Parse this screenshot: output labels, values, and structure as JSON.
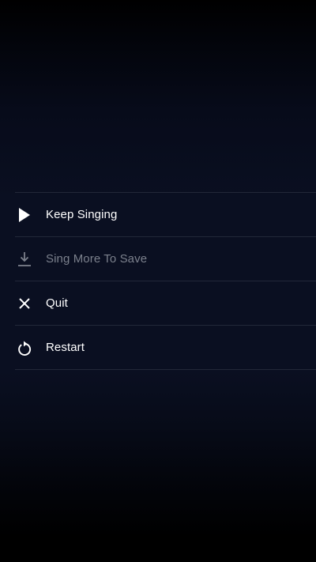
{
  "menu": {
    "items": [
      {
        "label": "Keep Singing",
        "icon": "play-icon",
        "enabled": true
      },
      {
        "label": "Sing More To Save",
        "icon": "download-icon",
        "enabled": false
      },
      {
        "label": "Quit",
        "icon": "close-icon",
        "enabled": true
      },
      {
        "label": "Restart",
        "icon": "restart-icon",
        "enabled": true
      }
    ]
  },
  "colors": {
    "background": "#0a0f21",
    "text": "#ffffff",
    "disabled_text": "#7b808c",
    "divider": "#222838"
  }
}
